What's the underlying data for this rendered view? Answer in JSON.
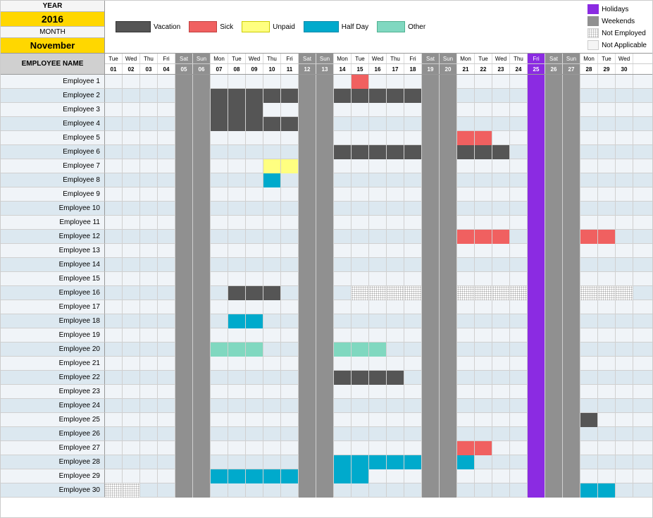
{
  "header": {
    "year_label": "YEAR",
    "year_value": "2016",
    "month_label": "MONTH",
    "month_value": "November"
  },
  "legend": {
    "items": [
      {
        "label": "Vacation",
        "color": "#555555"
      },
      {
        "label": "Sick",
        "color": "#f06060"
      },
      {
        "label": "Unpaid",
        "color": "#ffff80"
      },
      {
        "label": "Half Day",
        "color": "#00aacc"
      },
      {
        "label": "Other",
        "color": "#80d8c0"
      }
    ],
    "right_items": [
      {
        "label": "Holidays",
        "color": "#8b2be2"
      },
      {
        "label": "Weekends",
        "color": "#909090"
      },
      {
        "label": "Not Employed",
        "dotted": true
      },
      {
        "label": "Not Applicable",
        "white": true
      }
    ]
  },
  "column_header": "EMPLOYEE NAME",
  "days": {
    "weekdays": [
      "Tue",
      "Wed",
      "Thu",
      "Fri",
      "Sat",
      "Sun",
      "Mon",
      "Tue",
      "Wed",
      "Thu",
      "Fri",
      "Sat",
      "Sun",
      "Mon",
      "Tue",
      "Wed",
      "Thu",
      "Fri",
      "Sat",
      "Sun",
      "Mon",
      "Tue",
      "Wed",
      "Thu",
      "Fri",
      "Sat",
      "Sun",
      "Mon",
      "Tue",
      "Wed"
    ],
    "numbers": [
      "01",
      "02",
      "03",
      "04",
      "05",
      "06",
      "07",
      "08",
      "09",
      "10",
      "11",
      "12",
      "13",
      "14",
      "15",
      "16",
      "17",
      "18",
      "19",
      "20",
      "21",
      "22",
      "23",
      "24",
      "25",
      "26",
      "27",
      "28",
      "29",
      "30"
    ]
  },
  "employees": [
    {
      "name": "Employee 1"
    },
    {
      "name": "Employee 2"
    },
    {
      "name": "Employee 3"
    },
    {
      "name": "Employee 4"
    },
    {
      "name": "Employee 5"
    },
    {
      "name": "Employee 6"
    },
    {
      "name": "Employee 7"
    },
    {
      "name": "Employee 8"
    },
    {
      "name": "Employee 9"
    },
    {
      "name": "Employee 10"
    },
    {
      "name": "Employee 11"
    },
    {
      "name": "Employee 12"
    },
    {
      "name": "Employee 13"
    },
    {
      "name": "Employee 14"
    },
    {
      "name": "Employee 15"
    },
    {
      "name": "Employee 16"
    },
    {
      "name": "Employee 17"
    },
    {
      "name": "Employee 18"
    },
    {
      "name": "Employee 19"
    },
    {
      "name": "Employee 20"
    },
    {
      "name": "Employee 21"
    },
    {
      "name": "Employee 22"
    },
    {
      "name": "Employee 23"
    },
    {
      "name": "Employee 24"
    },
    {
      "name": "Employee 25"
    },
    {
      "name": "Employee 26"
    },
    {
      "name": "Employee 27"
    },
    {
      "name": "Employee 28"
    },
    {
      "name": "Employee 29"
    },
    {
      "name": "Employee 30"
    }
  ]
}
